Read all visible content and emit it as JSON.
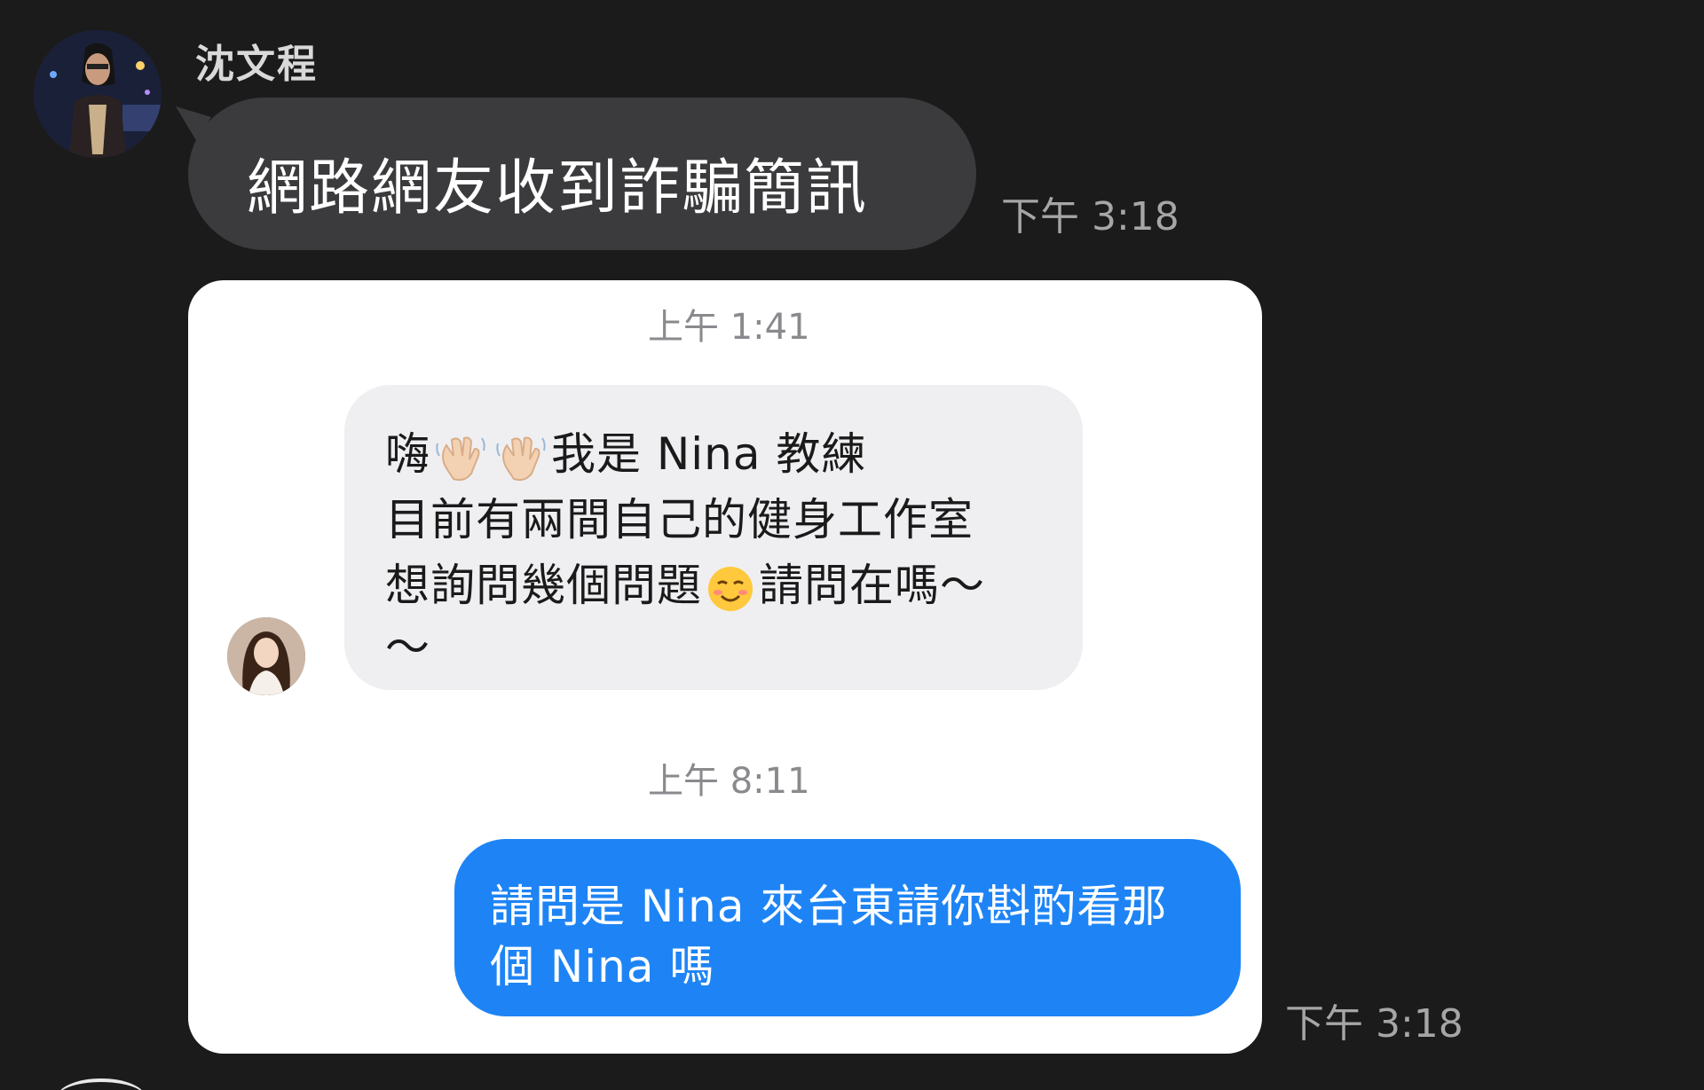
{
  "message1": {
    "sender_name": "沈文程",
    "text": "網路網友收到詐騙簡訊",
    "time": "下午 3:18"
  },
  "screenshot": {
    "time_first": "上午 1:41",
    "incoming": {
      "line1_prefix": "嗨",
      "line1_suffix": "我是 Nina 教練",
      "line2": "目前有兩間自己的健身工作室",
      "line3_prefix": "想詢問幾個問題",
      "line3_suffix": "請問在嗎～",
      "line4": "～",
      "emoji_wave": "waving-hand",
      "emoji_smile": "smiling-face"
    },
    "time_second": "上午 8:11",
    "outgoing": {
      "line1": "請問是 Nina 來台東請你斟酌看那",
      "line2": "個 Nina 嗎"
    }
  },
  "message2": {
    "time": "下午 3:18"
  },
  "colors": {
    "background": "#1b1b1c",
    "dark_bubble": "#3b3b3d",
    "blue_bubble": "#1e84f5",
    "grey_bubble": "#efeff1"
  }
}
